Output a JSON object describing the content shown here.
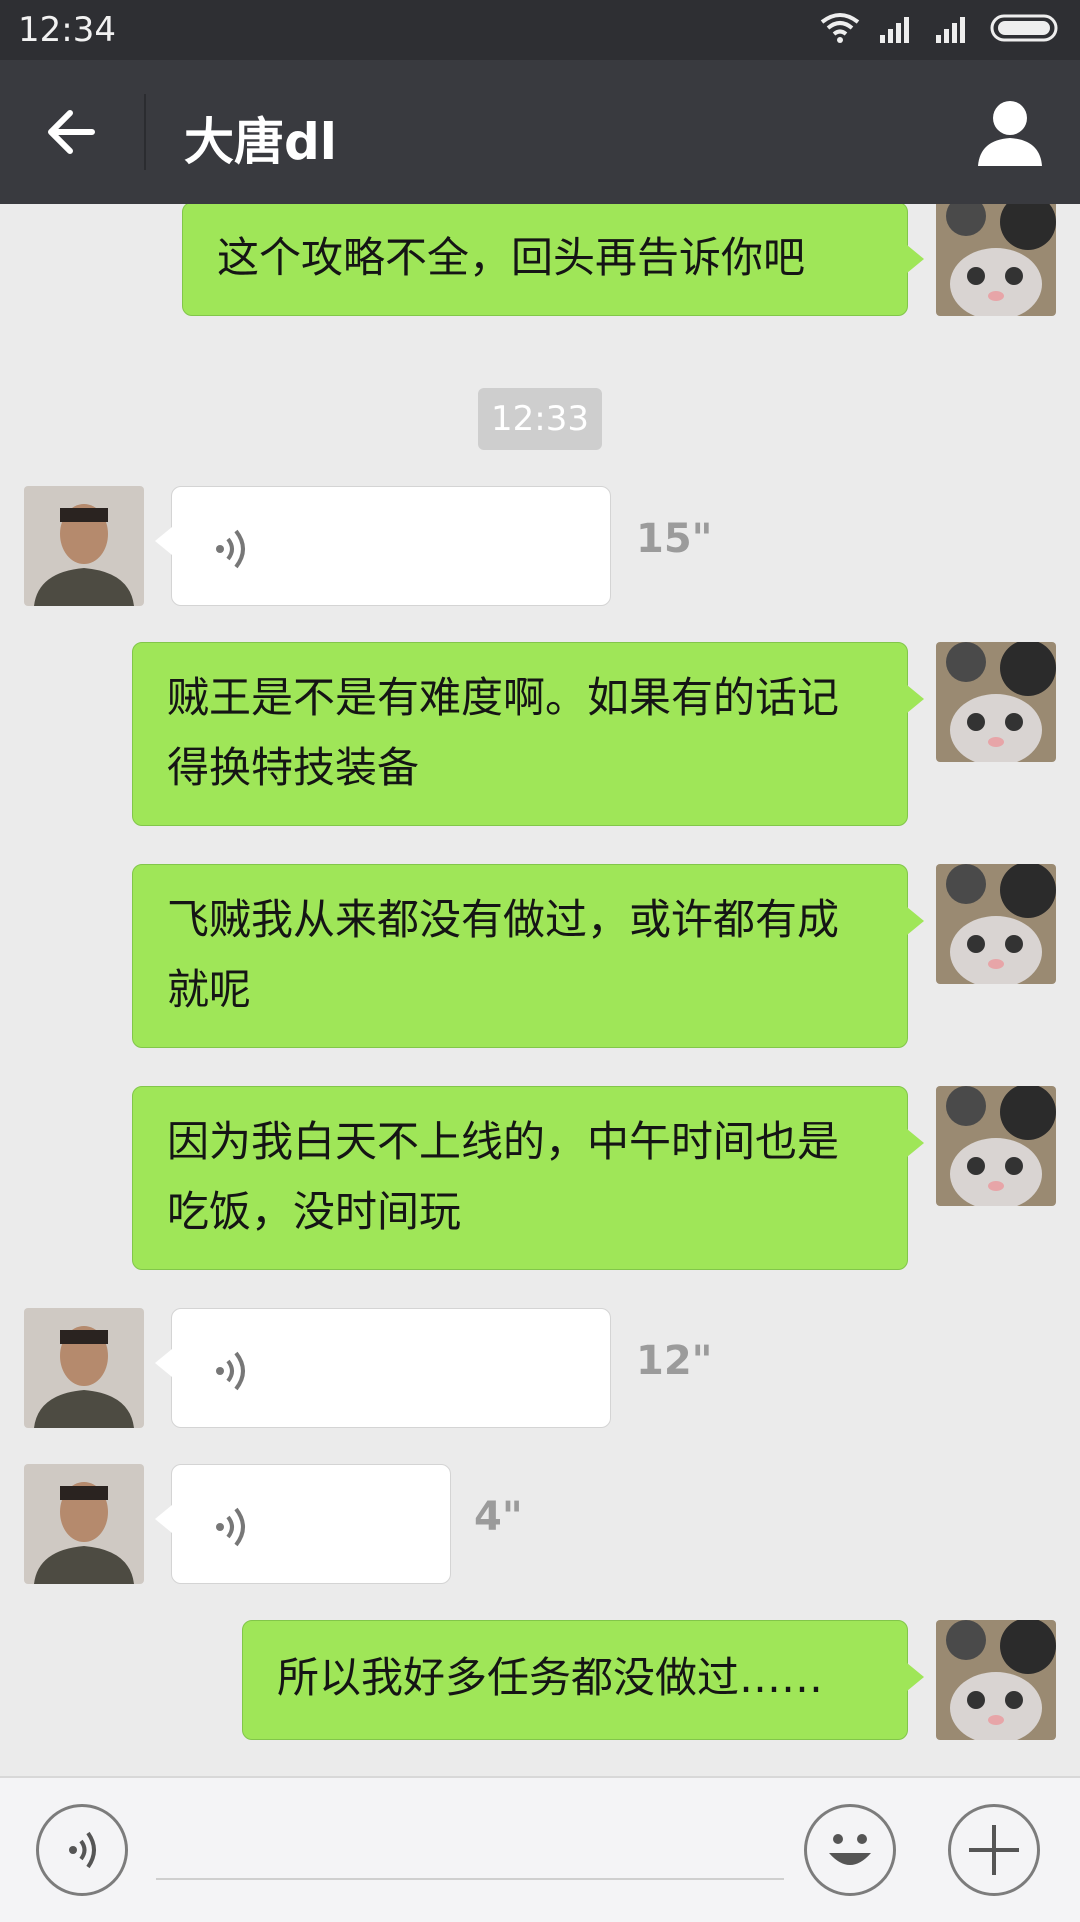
{
  "status_bar": {
    "time": "12:34"
  },
  "header": {
    "title": "大唐dl"
  },
  "messages": [
    {
      "side": "right",
      "type": "text",
      "text": "这个攻略不全，回头再告诉你吧"
    },
    {
      "type": "timestamp",
      "text": "12:33"
    },
    {
      "side": "left",
      "type": "voice",
      "duration": "15\""
    },
    {
      "side": "right",
      "type": "text",
      "text": "贼王是不是有难度啊。如果有的话记得换特技装备"
    },
    {
      "side": "right",
      "type": "text",
      "text": "飞贼我从来都没有做过，或许都有成就呢"
    },
    {
      "side": "right",
      "type": "text",
      "text": "因为我白天不上线的，中午时间也是吃饭，没时间玩"
    },
    {
      "side": "left",
      "type": "voice",
      "duration": "12\""
    },
    {
      "side": "left",
      "type": "voice",
      "duration": "4\""
    },
    {
      "side": "right",
      "type": "text",
      "text": "所以我好多任务都没做过……"
    }
  ],
  "input_bar": {
    "placeholder": ""
  },
  "colors": {
    "sent_bubble": "#9fe658",
    "received_bubble": "#ffffff",
    "header_bg": "#393a3f",
    "chat_bg": "#ebebeb"
  }
}
